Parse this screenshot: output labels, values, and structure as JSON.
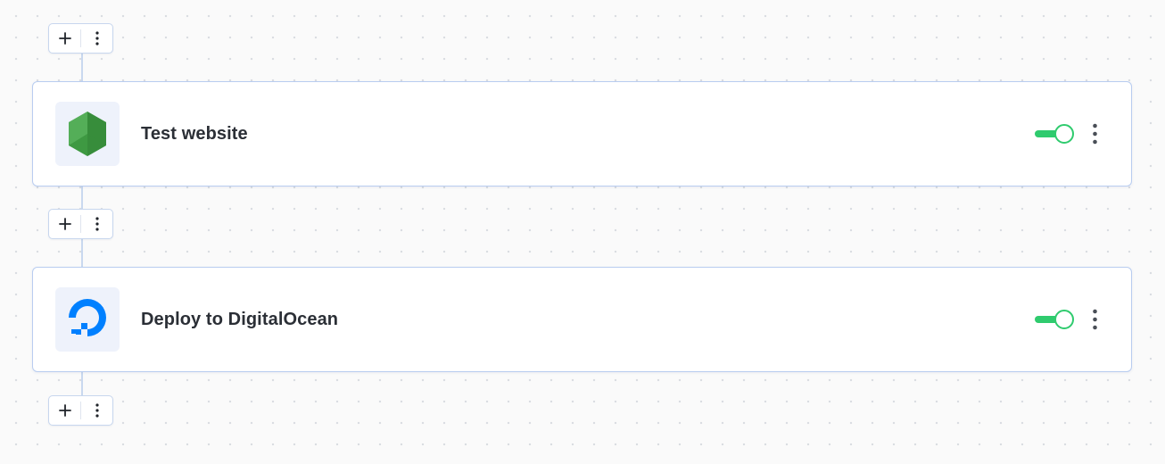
{
  "pipeline": {
    "steps": [
      {
        "title": "Test website",
        "logo": "nodejs-hexagon-icon",
        "enabled": true
      },
      {
        "title": "Deploy to DigitalOcean",
        "logo": "digitalocean-icon",
        "enabled": true
      }
    ],
    "add_controls": [
      {
        "add": "plus-icon",
        "menu": "vertical-dots-icon"
      },
      {
        "add": "plus-icon",
        "menu": "vertical-dots-icon"
      },
      {
        "add": "plus-icon",
        "menu": "vertical-dots-icon"
      }
    ]
  },
  "colors": {
    "toggle_on": "#2fcb6e",
    "card_border": "#b9cdf0",
    "node_green": "#43a047",
    "digitalocean_blue": "#0080ff",
    "background": "#fafafa"
  }
}
